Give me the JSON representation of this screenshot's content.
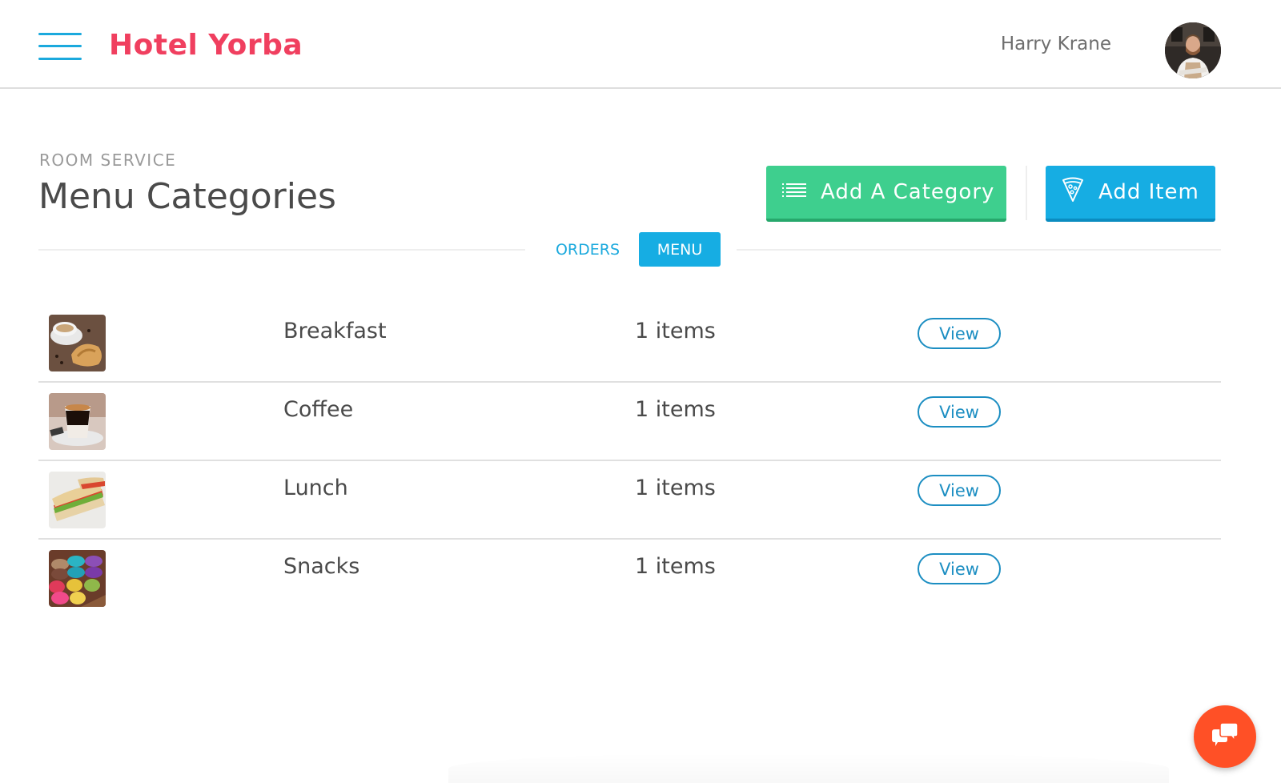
{
  "header": {
    "menu_icon": "hamburger-icon",
    "logo_text": "Hotel Yorba",
    "user_name": "Harry Krane",
    "avatar_icon": "user-avatar"
  },
  "page": {
    "breadcrumb": "ROOM SERVICE",
    "title": "Menu Categories"
  },
  "actions": {
    "add_category_label": "Add A Category",
    "add_category_icon": "list-icon",
    "add_item_label": "Add Item",
    "add_item_icon": "pizza-slice-icon"
  },
  "tabs": [
    {
      "label": "ORDERS",
      "active": false
    },
    {
      "label": "MENU",
      "active": true
    }
  ],
  "categories": [
    {
      "name": "Breakfast",
      "count": "1 items",
      "action": "View",
      "thumb": "breakfast-photo"
    },
    {
      "name": "Coffee",
      "count": "1 items",
      "action": "View",
      "thumb": "coffee-photo"
    },
    {
      "name": "Lunch",
      "count": "1 items",
      "action": "View",
      "thumb": "lunch-photo"
    },
    {
      "name": "Snacks",
      "count": "1 items",
      "action": "View",
      "thumb": "snacks-photo"
    }
  ],
  "chat": {
    "icon": "chat-bubbles-icon"
  },
  "colors": {
    "brand": "#f03f5f",
    "accent_blue": "#16ade3",
    "accent_green": "#3ecf8e",
    "chat_orange": "#ff5026"
  }
}
